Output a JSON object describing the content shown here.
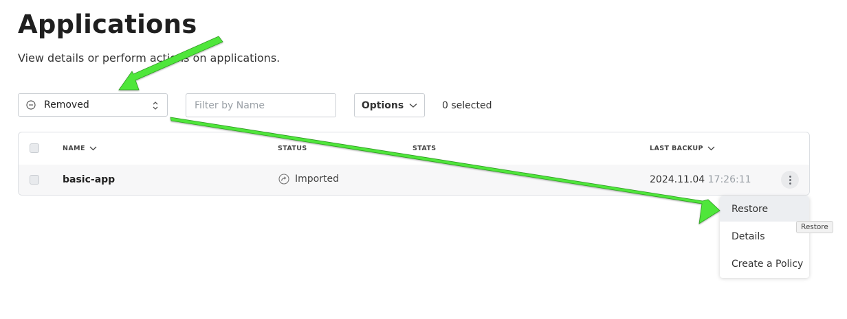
{
  "page": {
    "title": "Applications",
    "subtitle": "View details or perform actions on applications."
  },
  "toolbar": {
    "filter_value": "Removed",
    "search_placeholder": "Filter by Name",
    "options_label": "Options",
    "selected_count": "0 selected"
  },
  "table": {
    "columns": {
      "name": "NAME",
      "status": "STATUS",
      "stats": "STATS",
      "last_backup": "LAST BACKUP"
    },
    "rows": [
      {
        "name": "basic-app",
        "status": "Imported",
        "backup_date": "2024.11.04",
        "backup_time": "17:26:11"
      }
    ]
  },
  "menu": {
    "items": [
      "Restore",
      "Details",
      "Create a Policy"
    ]
  },
  "tooltip": "Restore",
  "colors": {
    "annotation_arrow": "#4fe63a",
    "border": "#c9cdd2"
  },
  "icons": [
    "minus-circle-icon",
    "updown-chevron-icon",
    "chevron-down-icon",
    "imported-icon",
    "kebab-icon"
  ]
}
